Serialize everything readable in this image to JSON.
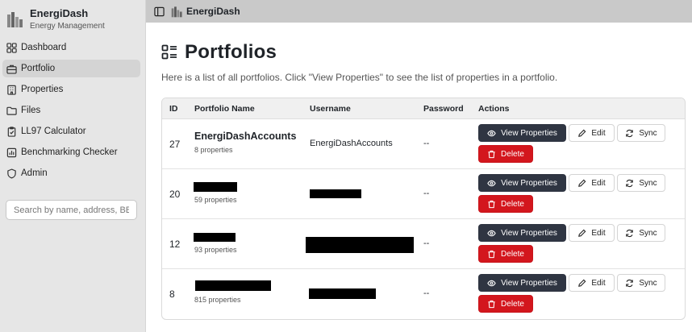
{
  "app": {
    "name": "EnergiDash",
    "subtitle": "Energy Management"
  },
  "sidebar": {
    "items": [
      {
        "label": "Dashboard",
        "icon": "dashboard-icon"
      },
      {
        "label": "Portfolio",
        "icon": "portfolio-icon",
        "active": true
      },
      {
        "label": "Properties",
        "icon": "building-icon"
      },
      {
        "label": "Files",
        "icon": "folder-icon"
      },
      {
        "label": "LL97 Calculator",
        "icon": "clipboard-icon"
      },
      {
        "label": "Benchmarking Checker",
        "icon": "chart-icon"
      },
      {
        "label": "Admin",
        "icon": "shield-icon"
      }
    ],
    "search_placeholder": "Search by name, address, BBL"
  },
  "topbar": {
    "title": "EnergiDash"
  },
  "page": {
    "title": "Portfolios",
    "intro": "Here is a list of all portfolios. Click \"View Properties\" to see the list of properties in a portfolio."
  },
  "table": {
    "headers": {
      "id": "ID",
      "name": "Portfolio Name",
      "username": "Username",
      "password": "Password",
      "actions": "Actions"
    },
    "rows": [
      {
        "id": "27",
        "name": "EnergiDashAccounts",
        "count": "8 properties",
        "username": "EnergiDashAccounts",
        "password": "--"
      },
      {
        "id": "20",
        "name": "",
        "count": "59 properties",
        "username": "",
        "password": "--"
      },
      {
        "id": "12",
        "name": "",
        "count": "93 properties",
        "username": "",
        "password": "--"
      },
      {
        "id": "8",
        "name": "",
        "count": "815 properties",
        "username": "",
        "password": "--"
      }
    ],
    "actions": {
      "view": "View Properties",
      "edit": "Edit",
      "sync": "Sync",
      "delete": "Delete"
    }
  },
  "colors": {
    "sidebar_bg": "#e6e6e6",
    "topbar_bg": "#c9c9c9",
    "view_button": "#2f3542",
    "delete_button": "#d3161d"
  }
}
